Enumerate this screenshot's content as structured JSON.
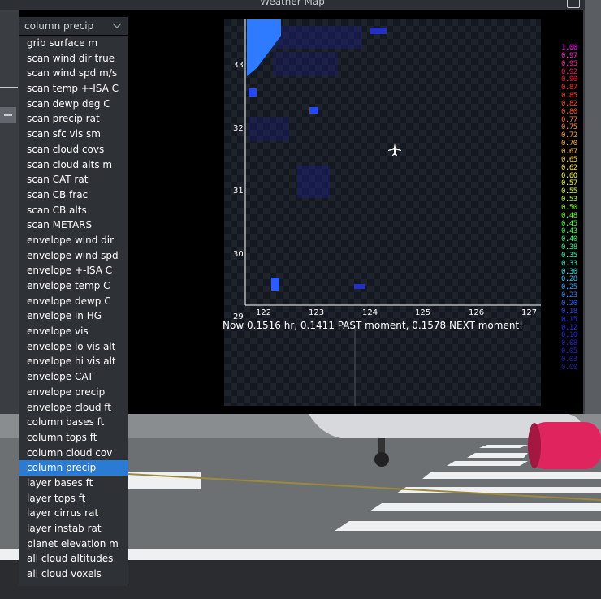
{
  "window": {
    "title": "Weather Map"
  },
  "dropdown": {
    "selected": "column precip",
    "items": [
      "grib surface m",
      "scan wind dir true",
      "scan wind spd m/s",
      "scan temp +-ISA C",
      "scan dewp deg C",
      "scan precip rat",
      "scan sfc vis sm",
      "scan cloud covs",
      "scan cloud alts m",
      "scan CAT rat",
      "scan CB frac",
      "scan CB alts",
      "scan METARS",
      "envelope wind dir",
      "envelope wind spd",
      "envelope +-ISA C",
      "envelope temp C",
      "envelope dewp C",
      "envelope in HG",
      "envelope vis",
      "envelope lo vis alt",
      "envelope hi vis alt",
      "envelope CAT",
      "envelope precip",
      "envelope cloud ft",
      "column bases ft",
      "column tops ft",
      "column cloud cov",
      "column precip",
      "layer bases ft",
      "layer tops ft",
      "layer cirrus rat",
      "layer instab rat",
      "planet elevation m",
      "all cloud altitudes",
      "all cloud voxels"
    ],
    "selected_index": 28
  },
  "map": {
    "y_ticks": [
      "33",
      "32",
      "31",
      "30",
      "29"
    ],
    "x_ticks": [
      "122",
      "123",
      "124",
      "125",
      "126",
      "127"
    ],
    "status": "Now 0.1516 hr, 0.1411 PAST moment, 0.1578 NEXT moment!",
    "plane_icon": "airplane-icon"
  },
  "scale": {
    "labels": [
      "1.00",
      "0.97",
      "0.95",
      "0.92",
      "0.90",
      "0.87",
      "0.85",
      "0.82",
      "0.80",
      "0.77",
      "0.75",
      "0.72",
      "0.70",
      "0.67",
      "0.65",
      "0.62",
      "0.60",
      "0.57",
      "0.55",
      "0.53",
      "0.50",
      "0.48",
      "0.45",
      "0.43",
      "0.40",
      "0.38",
      "0.35",
      "0.33",
      "0.30",
      "0.28",
      "0.25",
      "0.23",
      "0.20",
      "0.18",
      "0.15",
      "0.12",
      "0.10",
      "0.08",
      "0.05",
      "0.03",
      "0.00"
    ],
    "colors": [
      "#ff00ff",
      "#ff22cc",
      "#ff2299",
      "#ff1166",
      "#ff1133",
      "#ff2a20",
      "#ff3a22",
      "#ff4422",
      "#ff5522",
      "#ff7722",
      "#ff8822",
      "#ffa020",
      "#ffb020",
      "#ffc020",
      "#ffd020",
      "#ffe020",
      "#ffff20",
      "#eeff20",
      "#ccff20",
      "#aaff20",
      "#88ff20",
      "#66ff22",
      "#44ff33",
      "#33ff44",
      "#22ff66",
      "#22ff88",
      "#22ffaa",
      "#22ffcc",
      "#22eeee",
      "#22ccff",
      "#22aaff",
      "#2288ff",
      "#2266ff",
      "#2244ff",
      "#2233ff",
      "#2222ff",
      "#2020ee",
      "#2020dd",
      "#2020cc",
      "#2020bb",
      "#1f1f99"
    ]
  }
}
